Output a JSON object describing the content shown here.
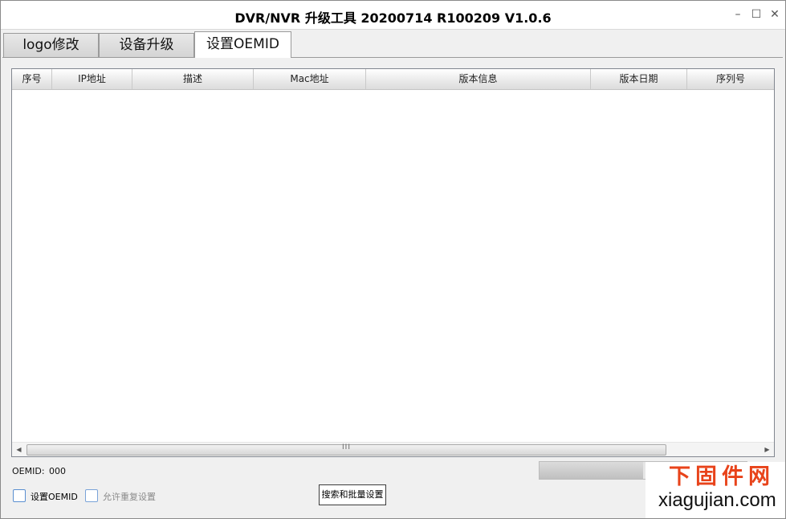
{
  "window": {
    "title": "DVR/NVR 升级工具 20200714 R100209 V1.0.6",
    "controls": {
      "minimize": "–",
      "maximize": "☐",
      "close": "✕"
    }
  },
  "tabs": [
    {
      "label": "logo修改",
      "active": false
    },
    {
      "label": "设备升级",
      "active": false
    },
    {
      "label": "设置OEMID",
      "active": true
    }
  ],
  "table": {
    "columns": [
      "序号",
      "IP地址",
      "描述",
      "Mac地址",
      "版本信息",
      "版本日期",
      "序列号"
    ],
    "rows": [],
    "scroll_grip": "III"
  },
  "oemid": {
    "label": "OEMID:",
    "value": "000"
  },
  "progress": {
    "value": 0.5
  },
  "checkboxes": [
    {
      "label": "设置OEMID",
      "checked": false,
      "enabled": true
    },
    {
      "label": "允许重复设置",
      "checked": false,
      "enabled": false
    }
  ],
  "buttons": {
    "search_batch": "搜索和批量设置"
  },
  "watermark": {
    "cn": "下固件网",
    "en": "xiagujian.com"
  }
}
